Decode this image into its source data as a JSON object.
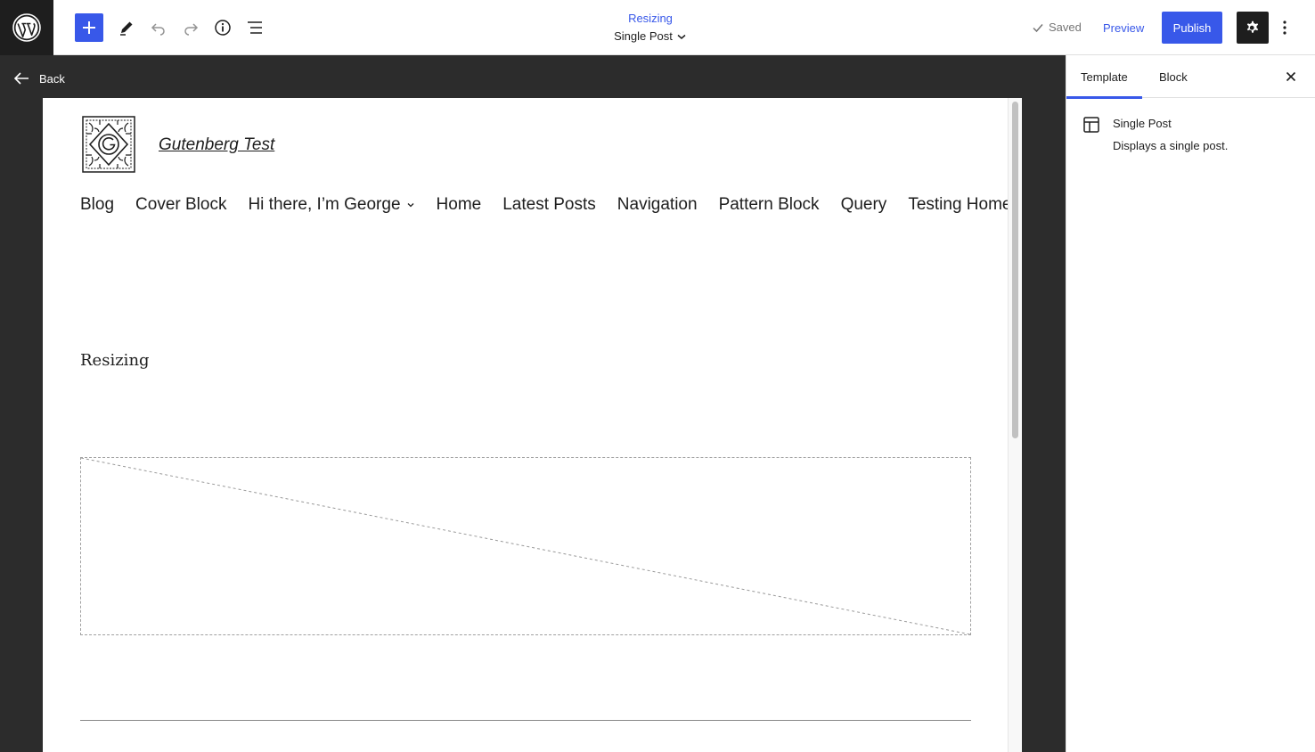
{
  "toolbar": {
    "add_label": "Add block",
    "document": {
      "post_name": "Resizing",
      "template_name": "Single Post"
    },
    "saved_label": "Saved",
    "preview_label": "Preview",
    "publish_label": "Publish"
  },
  "canvas": {
    "back_label": "Back",
    "site_title": "Gutenberg Test",
    "nav_items": [
      {
        "label": "Blog"
      },
      {
        "label": "Cover Block"
      },
      {
        "label": "Hi there, I’m George",
        "has_submenu": true
      },
      {
        "label": "Home"
      },
      {
        "label": "Latest Posts"
      },
      {
        "label": "Navigation"
      },
      {
        "label": "Pattern Block"
      },
      {
        "label": "Query"
      },
      {
        "label": "Testing Home"
      }
    ],
    "post_title": "Resizing"
  },
  "sidebar": {
    "tabs": [
      "Template",
      "Block"
    ],
    "active_tab": "Template",
    "template": {
      "name": "Single Post",
      "description": "Displays a single post."
    }
  },
  "colors": {
    "accent": "#3858e9",
    "dark": "#1e1e1e",
    "canvas_bg": "#2c2c2c"
  }
}
